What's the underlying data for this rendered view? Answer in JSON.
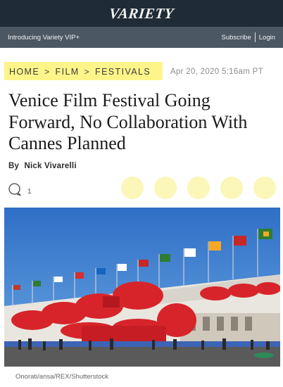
{
  "header": {
    "logo_text": "Variety"
  },
  "vip_bar": {
    "intro": "Introducing Variety VIP+",
    "subscribe_label": "Subscribe",
    "login_label": "Login"
  },
  "breadcrumb": {
    "items": [
      "HOME",
      "FILM",
      "FESTIVALS"
    ],
    "separator": ">"
  },
  "article": {
    "date": "Apr 20, 2020 5:16am PT",
    "title": "Venice Film Festival Going Forward, No Collaboration With Cannes Planned",
    "byline_prefix": "By",
    "author": "Nick Vivarelli",
    "comment_count": "1"
  },
  "image": {
    "caption": "Onorati/ansa/REX/Shutterstock"
  },
  "colors": {
    "topbar": "#1f2b36",
    "vipbar": "#4b5763",
    "highlight": "#fdf58a",
    "share_bubble": "#fbf7b8"
  }
}
